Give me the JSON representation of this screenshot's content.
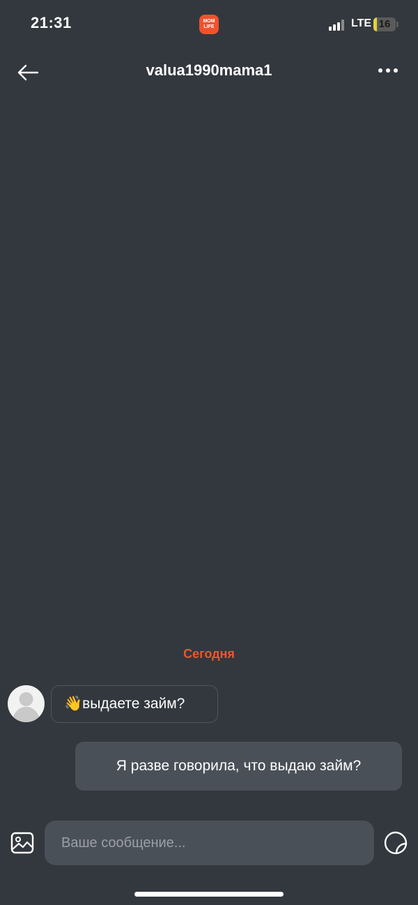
{
  "status_bar": {
    "time": "21:31",
    "app_badge_text": "MOM LIFE",
    "network": "LTE",
    "battery_level": "16",
    "battery_percent": 16
  },
  "header": {
    "title": "valua1990mama1"
  },
  "chat": {
    "date_separator": "Сегодня",
    "messages": [
      {
        "direction": "incoming",
        "text": "👋выдаете займ?"
      },
      {
        "direction": "outgoing",
        "text": "Я разве говорила, что выдаю займ?"
      }
    ]
  },
  "composer": {
    "placeholder": "Ваше сообщение..."
  },
  "colors": {
    "background": "#33383e",
    "bubble": "#4a5058",
    "accent": "#e8582d",
    "battery": "#e6d23c"
  },
  "icons": {
    "back": "arrow-left-icon",
    "more": "more-dots-icon",
    "image": "image-icon",
    "sticker": "sticker-icon",
    "avatar": "avatar-placeholder-icon"
  }
}
